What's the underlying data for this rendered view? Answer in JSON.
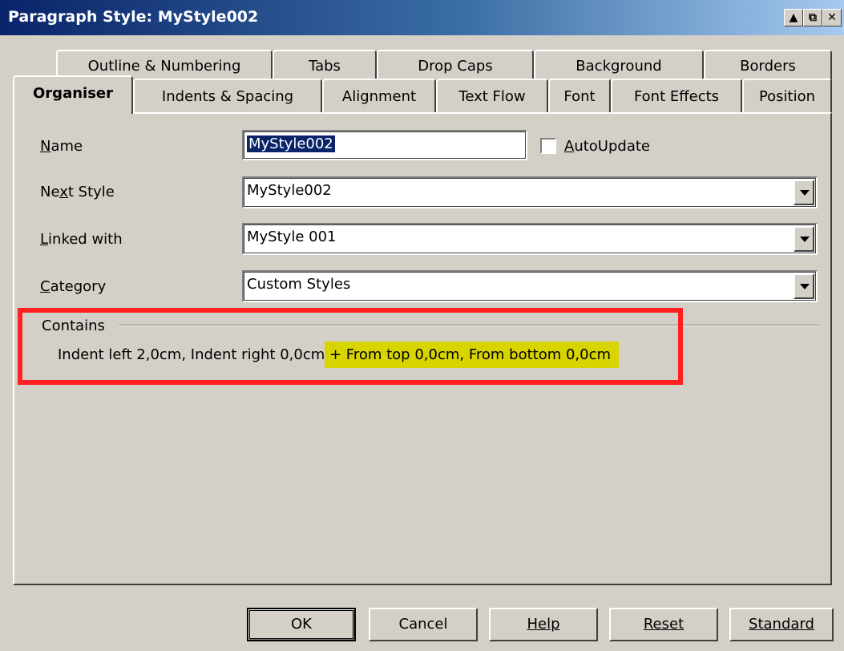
{
  "window": {
    "title": "Paragraph Style: MyStyle002",
    "controls": [
      "help-arrow-icon",
      "maximize-icon",
      "close-icon"
    ]
  },
  "tabs_row1": [
    "Outline & Numbering",
    "Tabs",
    "Drop Caps",
    "Background",
    "Borders"
  ],
  "tabs_row2": [
    "Organiser",
    "Indents & Spacing",
    "Alignment",
    "Text Flow",
    "Font",
    "Font Effects",
    "Position"
  ],
  "active_tab": "Organiser",
  "form": {
    "name": {
      "label": "Name",
      "value": "MyStyle002"
    },
    "autoupdate": {
      "label": "AutoUpdate",
      "checked": false
    },
    "next_style": {
      "label": "Next Style",
      "value": "MyStyle002"
    },
    "linked_with": {
      "label": "Linked with",
      "value": "MyStyle 001"
    },
    "category": {
      "label": "Category",
      "value": "Custom Styles"
    }
  },
  "contains": {
    "heading": "Contains",
    "text_plain": "Indent left 2,0cm, Indent right 0,0cm",
    "text_highlighted": " + From top 0,0cm, From bottom 0,0cm"
  },
  "buttons": {
    "ok": "OK",
    "cancel": "Cancel",
    "help": "Help",
    "reset": "Reset",
    "standard": "Standard"
  },
  "colors": {
    "annotation_box": "#ff2020",
    "highlight": "#d8d400",
    "title_bar": "#0a246a"
  }
}
